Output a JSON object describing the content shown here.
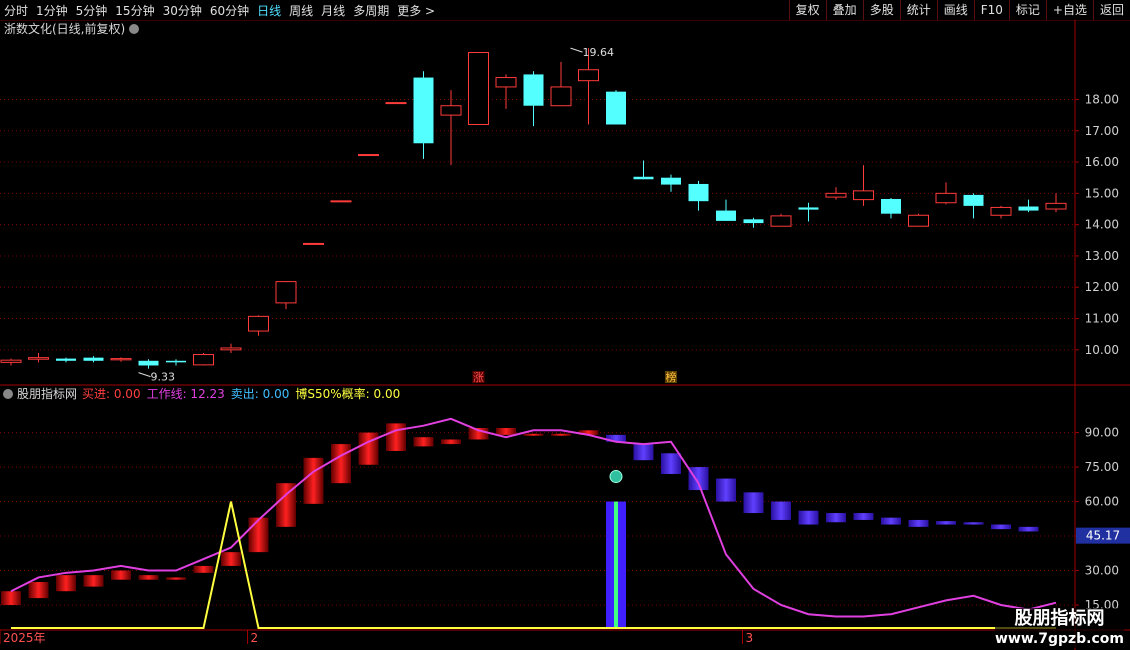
{
  "toolbar": {
    "periods": [
      "分时",
      "1分钟",
      "5分钟",
      "15分钟",
      "30分钟",
      "60分钟",
      "日线",
      "周线",
      "月线",
      "多周期",
      "更多 >"
    ],
    "active_period": "日线",
    "actions": [
      "复权",
      "叠加",
      "多股",
      "统计",
      "画线",
      "F10",
      "标记",
      "+自选",
      "返回"
    ]
  },
  "colors": {
    "up": "#ff3b3b",
    "down": "#54ffff",
    "grid": "#7a0000",
    "work_line": "#e040e0",
    "prob_line": "#ffff40",
    "axis_text": "#d0d0d0",
    "sell_bar": "#5030ff",
    "buy_bar": "#d01010"
  },
  "chart_data": [
    {
      "type": "candlestick",
      "title": "浙数文化(日线,前复权)",
      "ylim": [
        9.1,
        19.9
      ],
      "y_ticks": [
        10.0,
        11.0,
        12.0,
        13.0,
        14.0,
        15.0,
        16.0,
        17.0,
        18.0
      ],
      "annotations": {
        "high": "19.64",
        "low": "9.33",
        "marker1": "涨",
        "marker2": "榜"
      },
      "candles": [
        {
          "o": 9.6,
          "c": 9.67,
          "h": 9.72,
          "l": 9.5
        },
        {
          "o": 9.7,
          "c": 9.75,
          "h": 9.9,
          "l": 9.6
        },
        {
          "o": 9.72,
          "c": 9.65,
          "h": 9.75,
          "l": 9.6
        },
        {
          "o": 9.75,
          "c": 9.65,
          "h": 9.8,
          "l": 9.6
        },
        {
          "o": 9.68,
          "c": 9.72,
          "h": 9.76,
          "l": 9.62
        },
        {
          "o": 9.65,
          "c": 9.5,
          "h": 9.7,
          "l": 9.4
        },
        {
          "o": 9.65,
          "c": 9.6,
          "h": 9.7,
          "l": 9.5
        },
        {
          "o": 9.52,
          "c": 9.85,
          "h": 9.9,
          "l": 9.5
        },
        {
          "o": 10.0,
          "c": 10.06,
          "h": 10.2,
          "l": 9.9
        },
        {
          "o": 10.6,
          "c": 11.07,
          "h": 11.1,
          "l": 10.45
        },
        {
          "o": 11.5,
          "c": 12.18,
          "h": 12.2,
          "l": 11.3
        },
        {
          "o": 13.4,
          "c": 13.4,
          "h": 13.4,
          "l": 13.4
        },
        {
          "o": 14.76,
          "c": 14.76,
          "h": 14.76,
          "l": 14.76
        },
        {
          "o": 16.24,
          "c": 16.24,
          "h": 16.24,
          "l": 16.24
        },
        {
          "o": 17.9,
          "c": 17.9,
          "h": 17.9,
          "l": 17.9
        },
        {
          "o": 18.7,
          "c": 16.6,
          "h": 18.9,
          "l": 16.1
        },
        {
          "o": 17.5,
          "c": 17.8,
          "h": 18.3,
          "l": 15.9
        },
        {
          "o": 17.2,
          "c": 19.5,
          "h": 19.5,
          "l": 17.2
        },
        {
          "o": 18.4,
          "c": 18.7,
          "h": 18.8,
          "l": 17.7
        },
        {
          "o": 18.8,
          "c": 17.8,
          "h": 18.9,
          "l": 17.15
        },
        {
          "o": 17.8,
          "c": 18.4,
          "h": 19.2,
          "l": 17.8
        },
        {
          "o": 18.6,
          "c": 18.95,
          "h": 19.64,
          "l": 17.2
        },
        {
          "o": 18.25,
          "c": 17.2,
          "h": 18.3,
          "l": 17.2
        },
        {
          "o": 15.53,
          "c": 15.45,
          "h": 16.05,
          "l": 15.45
        },
        {
          "o": 15.5,
          "c": 15.28,
          "h": 15.6,
          "l": 15.05
        },
        {
          "o": 15.3,
          "c": 14.75,
          "h": 15.4,
          "l": 14.45
        },
        {
          "o": 14.45,
          "c": 14.12,
          "h": 14.8,
          "l": 14.12
        },
        {
          "o": 14.17,
          "c": 14.05,
          "h": 14.22,
          "l": 13.9
        },
        {
          "o": 13.95,
          "c": 14.28,
          "h": 14.35,
          "l": 13.95
        },
        {
          "o": 14.55,
          "c": 14.48,
          "h": 14.7,
          "l": 14.1
        },
        {
          "o": 14.88,
          "c": 15.0,
          "h": 15.2,
          "l": 14.8
        },
        {
          "o": 14.8,
          "c": 15.08,
          "h": 15.9,
          "l": 14.6
        },
        {
          "o": 14.82,
          "c": 14.35,
          "h": 14.85,
          "l": 14.2
        },
        {
          "o": 13.95,
          "c": 14.3,
          "h": 14.35,
          "l": 13.95
        },
        {
          "o": 14.7,
          "c": 15.0,
          "h": 15.35,
          "l": 14.65
        },
        {
          "o": 14.95,
          "c": 14.6,
          "h": 15.0,
          "l": 14.2
        },
        {
          "o": 14.3,
          "c": 14.55,
          "h": 14.6,
          "l": 14.2
        },
        {
          "o": 14.58,
          "c": 14.45,
          "h": 14.8,
          "l": 14.4
        },
        {
          "o": 14.5,
          "c": 14.68,
          "h": 15.0,
          "l": 14.4
        }
      ]
    },
    {
      "type": "indicator",
      "title": "股朋指标网",
      "legend": [
        {
          "label": "买进: 0.00",
          "color": "#ff4040"
        },
        {
          "label": "工作线: 12.23",
          "color": "#e040e0"
        },
        {
          "label": "卖出: 0.00",
          "color": "#40c0ff"
        },
        {
          "label": "博S50%概率: 0.00",
          "color": "#ffff40"
        }
      ],
      "ylim": [
        5,
        102
      ],
      "y_ticks": [
        15.0,
        30.0,
        45.0,
        60.0,
        75.0,
        90.0
      ],
      "current_value": "45.17",
      "x_labels": [
        {
          "index": 0,
          "text": "2025年"
        },
        {
          "index": 9,
          "text": "2"
        },
        {
          "index": 27,
          "text": "3"
        }
      ],
      "work_line": [
        21,
        27,
        29,
        30,
        32,
        30,
        30,
        35,
        40,
        52,
        63,
        73,
        80,
        86,
        91,
        93,
        96,
        91,
        88,
        91,
        91,
        89,
        86,
        85,
        86,
        68,
        37,
        22,
        15,
        11,
        10,
        10,
        11,
        14,
        17,
        19,
        15,
        13,
        16,
        15,
        14,
        13,
        13,
        13
      ],
      "bars": [
        {
          "lo": 15,
          "hi": 21,
          "kind": "buy"
        },
        {
          "lo": 18,
          "hi": 25,
          "kind": "buy"
        },
        {
          "lo": 21,
          "hi": 28,
          "kind": "buy"
        },
        {
          "lo": 23,
          "hi": 28,
          "kind": "buy"
        },
        {
          "lo": 26,
          "hi": 30,
          "kind": "buy"
        },
        {
          "lo": 26,
          "hi": 28,
          "kind": "buy"
        },
        {
          "lo": 26,
          "hi": 27,
          "kind": "buy"
        },
        {
          "lo": 29,
          "hi": 32,
          "kind": "buy"
        },
        {
          "lo": 32,
          "hi": 38,
          "kind": "buy"
        },
        {
          "lo": 38,
          "hi": 53,
          "kind": "buy"
        },
        {
          "lo": 49,
          "hi": 68,
          "kind": "buy"
        },
        {
          "lo": 59,
          "hi": 79,
          "kind": "buy"
        },
        {
          "lo": 68,
          "hi": 85,
          "kind": "buy"
        },
        {
          "lo": 76,
          "hi": 90,
          "kind": "buy"
        },
        {
          "lo": 82,
          "hi": 94,
          "kind": "buy"
        },
        {
          "lo": 84,
          "hi": 88,
          "kind": "buy"
        },
        {
          "lo": 85,
          "hi": 87,
          "kind": "buy"
        },
        {
          "lo": 87,
          "hi": 92,
          "kind": "buy"
        },
        {
          "lo": 89,
          "hi": 92,
          "kind": "buy"
        },
        {
          "lo": 89,
          "hi": 89.5,
          "kind": "buy"
        },
        {
          "lo": 89,
          "hi": 89.5,
          "kind": "buy"
        },
        {
          "lo": 89,
          "hi": 91,
          "kind": "buy"
        },
        {
          "lo": 86,
          "hi": 89,
          "kind": "sell"
        },
        {
          "lo": 78,
          "hi": 85,
          "kind": "sell"
        },
        {
          "lo": 72,
          "hi": 81,
          "kind": "sell"
        },
        {
          "lo": 65,
          "hi": 75,
          "kind": "sell"
        },
        {
          "lo": 60,
          "hi": 70,
          "kind": "sell"
        },
        {
          "lo": 55,
          "hi": 64,
          "kind": "sell"
        },
        {
          "lo": 52,
          "hi": 60,
          "kind": "sell"
        },
        {
          "lo": 50,
          "hi": 56,
          "kind": "sell"
        },
        {
          "lo": 51,
          "hi": 55,
          "kind": "sell"
        },
        {
          "lo": 52,
          "hi": 55,
          "kind": "sell"
        },
        {
          "lo": 50,
          "hi": 53,
          "kind": "sell"
        },
        {
          "lo": 49,
          "hi": 52,
          "kind": "sell"
        },
        {
          "lo": 50,
          "hi": 51.5,
          "kind": "sell"
        },
        {
          "lo": 50,
          "hi": 51,
          "kind": "sell"
        },
        {
          "lo": 48,
          "hi": 50,
          "kind": "sell"
        },
        {
          "lo": 47,
          "hi": 49,
          "kind": "sell"
        }
      ],
      "signal_bar": {
        "index": 22,
        "lo": 5,
        "hi": 60
      },
      "prob_line": [
        5,
        5,
        5,
        5,
        5,
        5,
        5,
        5,
        60,
        5,
        5,
        5,
        5,
        5,
        5,
        5,
        5,
        5,
        5,
        5,
        5,
        5,
        5,
        5,
        5,
        5,
        5,
        5,
        5,
        5,
        5,
        5,
        5,
        5,
        5,
        5,
        5,
        5,
        5
      ]
    }
  ],
  "watermark": {
    "line1": "股朋指标网",
    "line2": "www.7gpzb.com"
  }
}
